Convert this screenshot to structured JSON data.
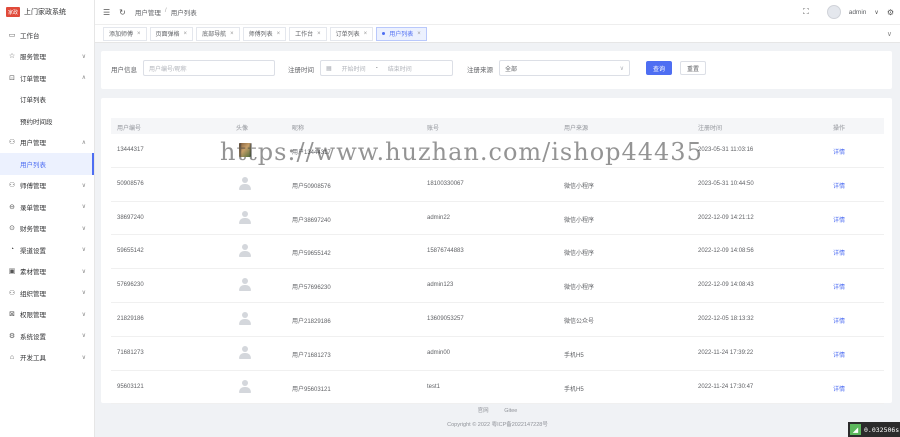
{
  "app": {
    "logo_text": "家政",
    "title": "上门家政系统"
  },
  "sidebar": {
    "items": [
      {
        "icon": "monitor-icon",
        "glyph": "▭",
        "label": "工作台",
        "arrow": false
      },
      {
        "icon": "star-icon",
        "glyph": "☆",
        "label": "服务管理",
        "arrow": true
      },
      {
        "icon": "cart-icon",
        "glyph": "⊡",
        "label": "订单管理",
        "arrow": true,
        "open": true
      },
      {
        "sub": true,
        "label": "订单列表"
      },
      {
        "sub": true,
        "label": "预约时间段"
      },
      {
        "icon": "user-icon",
        "glyph": "⚇",
        "label": "用户管理",
        "arrow": true,
        "open": true
      },
      {
        "sub": true,
        "label": "用户列表",
        "active": true
      },
      {
        "icon": "worker-icon",
        "glyph": "⚇",
        "label": "师傅管理",
        "arrow": true
      },
      {
        "icon": "settle-icon",
        "glyph": "⊖",
        "label": "录单管理",
        "arrow": true
      },
      {
        "icon": "finance-icon",
        "glyph": "⊙",
        "label": "财务管理",
        "arrow": true
      },
      {
        "icon": "channel-icon",
        "glyph": "◔",
        "label": "渠道设置",
        "arrow": true
      },
      {
        "icon": "material-icon",
        "glyph": "▣",
        "label": "素材管理",
        "arrow": true
      },
      {
        "icon": "org-icon",
        "glyph": "⚇",
        "label": "组织管理",
        "arrow": true
      },
      {
        "icon": "permission-icon",
        "glyph": "⊠",
        "label": "权限管理",
        "arrow": true
      },
      {
        "icon": "settings-icon",
        "glyph": "⚙",
        "label": "系统设置",
        "arrow": true
      },
      {
        "icon": "dev-icon",
        "glyph": "⌂",
        "label": "开发工具",
        "arrow": true
      }
    ]
  },
  "header": {
    "breadcrumb": [
      "用户管理",
      "用户列表"
    ],
    "username": "admin"
  },
  "tabs": [
    {
      "label": "添加师傅",
      "active": false
    },
    {
      "label": "页面弹格",
      "active": false
    },
    {
      "label": "底部导航",
      "active": false
    },
    {
      "label": "师傅列表",
      "active": false
    },
    {
      "label": "工作台",
      "active": false
    },
    {
      "label": "订单列表",
      "active": false
    },
    {
      "label": "用户列表",
      "active": true
    }
  ],
  "filter": {
    "user_info_label": "用户信息",
    "user_info_placeholder": "用户编号/昵称",
    "reg_time_label": "注册时间",
    "start_placeholder": "开始时间",
    "range_sep": "-",
    "end_placeholder": "结束时间",
    "source_label": "注册来源",
    "source_value": "全部",
    "query_button": "查询",
    "reset_button": "重置"
  },
  "table": {
    "headers": [
      "用户编号",
      "头像",
      "昵称",
      "账号",
      "用户来源",
      "注册时间",
      "操作"
    ],
    "rows": [
      {
        "id": "13444317",
        "photo": true,
        "nickname": "用户13444317",
        "account": "",
        "source": "",
        "time": "2023-05-31 11:03:16",
        "action": "详情"
      },
      {
        "id": "50908576",
        "photo": false,
        "nickname": "用户50908576",
        "account": "18100330067",
        "source": "微信小程序",
        "time": "2023-05-31 10:44:50",
        "action": "详情"
      },
      {
        "id": "38697240",
        "photo": false,
        "nickname": "用户38697240",
        "account": "admin22",
        "source": "微信小程序",
        "time": "2022-12-09 14:21:12",
        "action": "详情"
      },
      {
        "id": "59655142",
        "photo": false,
        "nickname": "用户59655142",
        "account": "15876744883",
        "source": "微信小程序",
        "time": "2022-12-09 14:08:56",
        "action": "详情"
      },
      {
        "id": "57696230",
        "photo": false,
        "nickname": "用户57696230",
        "account": "admin123",
        "source": "微信小程序",
        "time": "2022-12-09 14:08:43",
        "action": "详情"
      },
      {
        "id": "21829186",
        "photo": false,
        "nickname": "用户21829186",
        "account": "13609053257",
        "source": "微信公众号",
        "time": "2022-12-05 18:13:32",
        "action": "详情"
      },
      {
        "id": "71681273",
        "photo": false,
        "nickname": "用户71681273",
        "account": "admin00",
        "source": "手机H5",
        "time": "2022-11-24 17:39:22",
        "action": "详情"
      },
      {
        "id": "95603121",
        "photo": false,
        "nickname": "用户95603121",
        "account": "test1",
        "source": "手机H5",
        "time": "2022-11-24 17:30:47",
        "action": "详情"
      }
    ]
  },
  "footer": {
    "links": [
      "官网",
      "Gitee"
    ],
    "copyright": "Copyright © 2022 粤ICP备2022147228号"
  },
  "watermark": "https://www.huzhan.com/ishop44435",
  "timer": "0.032506s"
}
